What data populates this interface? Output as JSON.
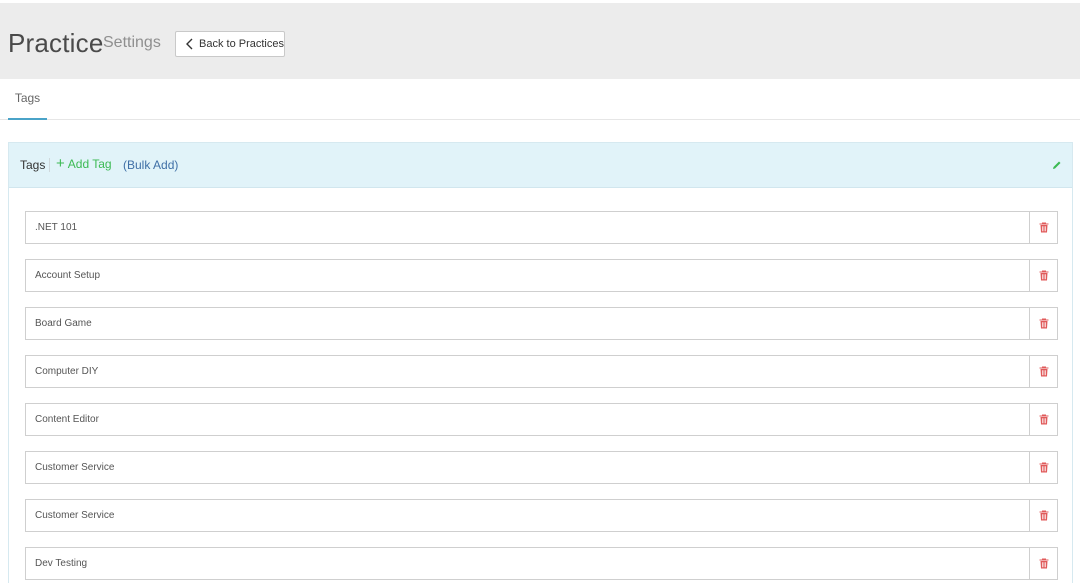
{
  "header": {
    "title": "Practice",
    "subtitle": "Settings",
    "back_label": "Back to Practices"
  },
  "tabs": [
    {
      "label": "Tags",
      "active": true
    }
  ],
  "panel": {
    "title": "Tags",
    "add_label": "Add Tag",
    "bulk_label": "(Bulk Add)"
  },
  "tags": [
    ".NET 101",
    "Account Setup",
    "Board Game",
    "Computer DIY",
    "Content Editor",
    "Customer Service",
    "Customer Service",
    "Dev Testing"
  ],
  "colors": {
    "accent": "#4aa3c8",
    "add": "#3cba54",
    "bulk": "#3f6fa6",
    "delete": "#e05a5a",
    "panel_bg": "#e1f3f9"
  },
  "icons": {
    "back": "chevron-left-icon",
    "add": "plus-icon",
    "edit": "pencil-icon",
    "delete": "trash-icon"
  }
}
